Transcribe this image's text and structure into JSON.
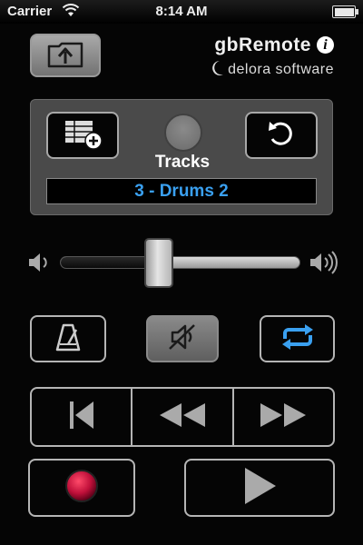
{
  "status_bar": {
    "carrier": "Carrier",
    "time": "8:14 AM"
  },
  "brand": {
    "title": "gbRemote",
    "subtitle": "delora software"
  },
  "tracks": {
    "label": "Tracks",
    "current": "3 - Drums 2"
  },
  "volume": {
    "level": 0.41
  },
  "colors": {
    "accent": "#3aa0f0",
    "record": "#c0103a",
    "panel": "#4a4a4a"
  },
  "icons": {
    "upload": "upload-folder-icon",
    "add_track": "add-track-icon",
    "undo": "undo-icon",
    "volume_low": "speaker-low-icon",
    "volume_high": "speaker-high-icon",
    "metronome": "metronome-icon",
    "mute": "speaker-muted-icon",
    "cycle": "cycle-icon",
    "rewind_start": "skip-to-start-icon",
    "rewind": "rewind-icon",
    "fast_forward": "fast-forward-icon",
    "record": "record-icon",
    "play": "play-icon"
  }
}
